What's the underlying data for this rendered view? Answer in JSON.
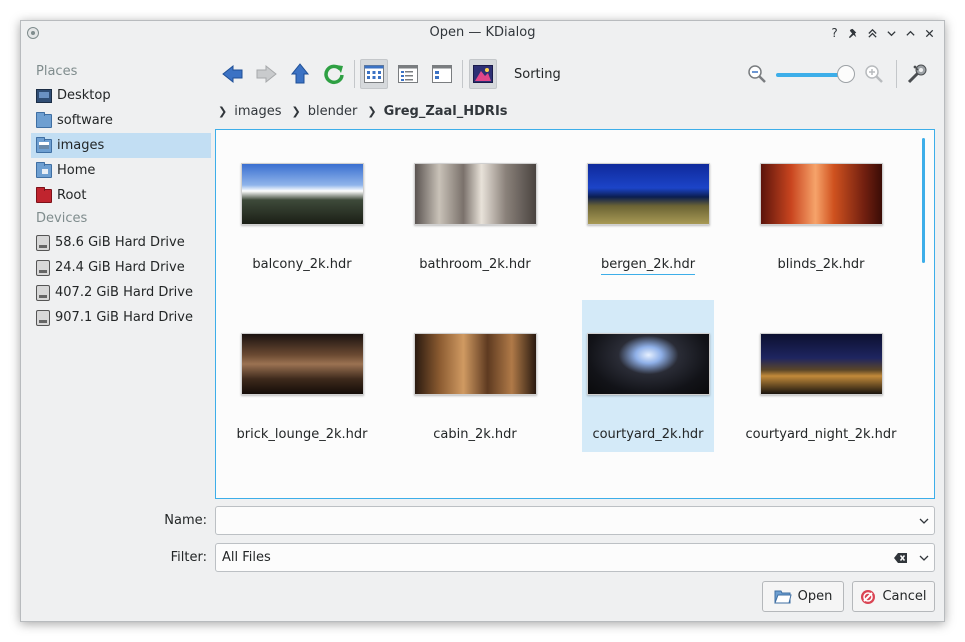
{
  "window": {
    "title": "Open — KDialog",
    "buttons": [
      "?",
      "pin",
      "keep-above",
      "minimize",
      "maximize",
      "close"
    ]
  },
  "sidebar": {
    "places_header": "Places",
    "places": [
      {
        "label": "Desktop",
        "icon": "desktop-icon"
      },
      {
        "label": "software",
        "icon": "folder-icon"
      },
      {
        "label": "images",
        "icon": "image-folder-icon",
        "active": true
      },
      {
        "label": "Home",
        "icon": "home-icon"
      },
      {
        "label": "Root",
        "icon": "root-folder-icon"
      }
    ],
    "devices_header": "Devices",
    "devices": [
      {
        "label": "58.6 GiB Hard Drive"
      },
      {
        "label": "24.4 GiB Hard Drive"
      },
      {
        "label": "407.2 GiB Hard Drive"
      },
      {
        "label": "907.1 GiB Hard Drive"
      }
    ]
  },
  "toolbar": {
    "sorting_label": "Sorting",
    "zoom_level": 1
  },
  "breadcrumb": {
    "items": [
      "images",
      "blender",
      "Greg_Zaal_HDRIs"
    ]
  },
  "files": [
    {
      "name": "balcony_2k.hdr",
      "gradient": "linear-gradient(180deg,#3a6fd0 0%,#8fb4ea 35%,#ffffff 45%,#3e4a3a 60%,#1b1f16 100%)"
    },
    {
      "name": "bathroom_2k.hdr",
      "gradient": "linear-gradient(90deg,#5b5451 0%,#c9c2b8 20%,#7a716b 40%,#e8e2d9 55%,#8a817a 75%,#4a4440 100%)"
    },
    {
      "name": "bergen_2k.hdr",
      "gradient": "linear-gradient(180deg,#0f2a9b 0%,#1c44c8 40%,#0b1e50 55%,#6b6334 70%,#a89a55 100%)"
    },
    {
      "name": "blinds_2k.hdr",
      "gradient": "linear-gradient(90deg,#5c140b 0%,#c9451f 25%,#f6a36a 45%,#d0521f 60%,#732010 85%,#3a0c06 100%)"
    },
    {
      "name": "brick_lounge_2k.hdr",
      "gradient": "linear-gradient(180deg,#1a1210 0%,#6b4a32 35%,#9b7252 50%,#3e2a1c 75%,#140c08 100%)"
    },
    {
      "name": "cabin_2k.hdr",
      "gradient": "linear-gradient(90deg,#2a1a10 0%,#8a5a30 20%,#d09a62 40%,#5e3a20 60%,#b07a48 80%,#2a1a10 100%)"
    },
    {
      "name": "courtyard_2k.hdr",
      "gradient": "radial-gradient(ellipse at 50% 35%,#e6f0ff 0%,#8fb0e8 15%,#2a2c36 35%,#121318 70%,#0a0a0c 100%)",
      "selected": true
    },
    {
      "name": "courtyard_night_2k.hdr",
      "gradient": "linear-gradient(180deg,#0c1030 0%,#1e2560 40%,#5a4628 60%,#c28a3a 70%,#1a140e 100%)"
    }
  ],
  "form": {
    "name_label": "Name:",
    "name_value": "",
    "filter_label": "Filter:",
    "filter_value": "All Files"
  },
  "buttons": {
    "open": "Open",
    "cancel": "Cancel"
  },
  "colors": {
    "accent": "#3daee9",
    "selection": "#c2def3"
  }
}
